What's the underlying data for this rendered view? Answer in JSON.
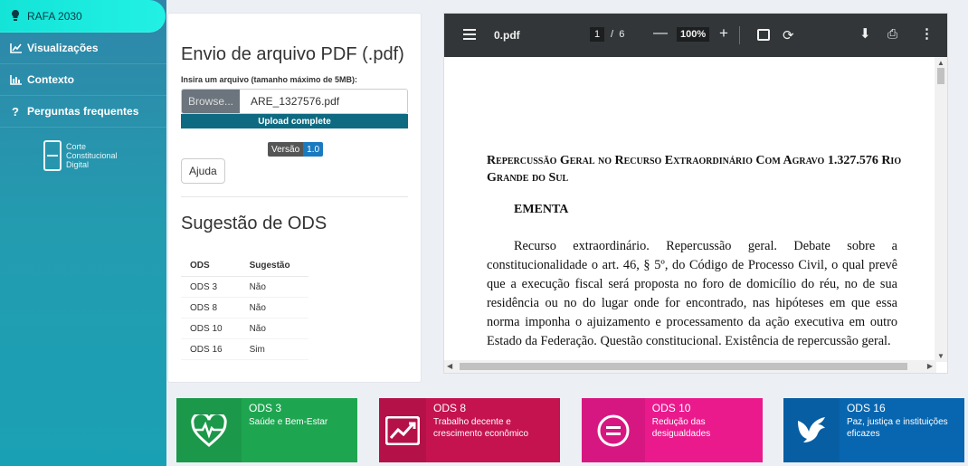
{
  "sidebar": {
    "items": [
      {
        "label": "RAFA 2030",
        "icon": "lightbulb-icon"
      },
      {
        "label": "Visualizações",
        "icon": "line-chart-icon"
      },
      {
        "label": "Contexto",
        "icon": "bar-chart-icon"
      },
      {
        "label": "Perguntas frequentes",
        "icon": "question-icon"
      }
    ],
    "logo_lines": [
      "Corte",
      "Constitucional",
      "Digital"
    ]
  },
  "upload": {
    "title": "Envio de arquivo PDF (.pdf)",
    "label": "Insira um arquivo (tamanho máximo de 5MB):",
    "browse_label": "Browse...",
    "filename": "ARE_1327576.pdf",
    "progress_text": "Upload complete",
    "progress": 1.0,
    "version_label": "Versão",
    "version_value": "1.0",
    "help_label": "Ajuda"
  },
  "suggestion": {
    "title": "Sugestão de ODS",
    "headers": [
      "ODS",
      "Sugestão"
    ],
    "rows": [
      [
        "ODS 3",
        "Não"
      ],
      [
        "ODS 8",
        "Não"
      ],
      [
        "ODS 10",
        "Não"
      ],
      [
        "ODS 16",
        "Sim"
      ]
    ]
  },
  "pdf": {
    "filename": "0.pdf",
    "page": "1",
    "page_sep": "/",
    "total_pages": "6",
    "zoom": "100%",
    "doc_title": "Repercussão Geral no Recurso Extraordinário Com Agravo 1.327.576 Rio Grande do Sul",
    "section": "EMENTA",
    "paragraph": "Recurso extraordinário. Repercussão geral. Debate sobre a constitucionalidade o art. 46, § 5º, do Código de Processo Civil, o qual prevê que a execução fiscal será proposta no foro de domicílio do réu, no de sua residência ou no do lugar onde for encontrado, nas hipóteses em que essa norma imponha o ajuizamento e processamento da ação executiva em outro Estado da Federação. Questão constitucional. Existência de repercussão geral."
  },
  "cards": [
    {
      "title": "ODS 3",
      "subtitle": "Saúde e Bem-Estar",
      "color": "#1ea550",
      "icon": "heart-pulse-icon"
    },
    {
      "title": "ODS 8",
      "subtitle": "Trabalho decente e crescimento econômico",
      "color": "#c4134f",
      "icon": "growth-chart-icon"
    },
    {
      "title": "ODS 10",
      "subtitle": "Redução das desigualdades",
      "color": "#ea1a8d",
      "icon": "equals-icon"
    },
    {
      "title": "ODS 16",
      "subtitle": "Paz, justiça e instituições eficazes",
      "color": "#0866b0",
      "icon": "dove-icon"
    }
  ]
}
